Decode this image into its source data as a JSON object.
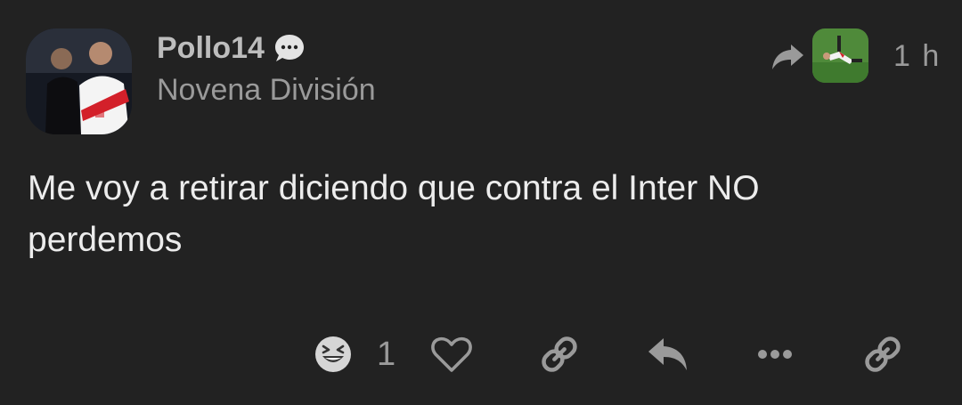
{
  "post": {
    "username": "Pollo14",
    "user_title": "Novena División",
    "date": "1 h",
    "body": "Me voy a retirar diciendo que contra el Inter NO perdemos"
  },
  "actions": {
    "reaction_icon": "laughing-emoji-icon",
    "reaction_count": "1",
    "like_icon": "heart-icon",
    "link_icon": "link-icon",
    "reply_icon": "reply-icon",
    "more_icon": "ellipsis-icon",
    "share_icon": "link-icon"
  },
  "colors": {
    "background": "#222222",
    "text": "#ececec",
    "muted": "#9a9a9a",
    "username": "#bdbdbd"
  }
}
